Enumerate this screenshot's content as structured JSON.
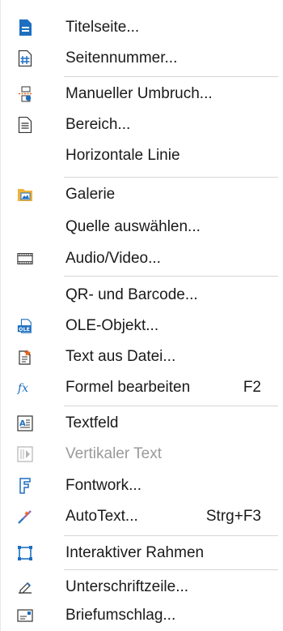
{
  "menu": {
    "items": [
      {
        "label": "Titelseite...",
        "icon": "title-page-icon",
        "shortcut": "",
        "enabled": true
      },
      {
        "label": "Seitennummer...",
        "icon": "page-number-icon",
        "shortcut": "",
        "enabled": true
      },
      {
        "label": "Manueller Umbruch...",
        "icon": "manual-break-icon",
        "shortcut": "",
        "enabled": true
      },
      {
        "label": "Bereich...",
        "icon": "section-icon",
        "shortcut": "",
        "enabled": true
      },
      {
        "label": "Horizontale Linie",
        "icon": "",
        "shortcut": "",
        "enabled": true
      },
      {
        "label": "Galerie",
        "icon": "gallery-icon",
        "shortcut": "",
        "enabled": true
      },
      {
        "label": "Quelle auswählen...",
        "icon": "",
        "shortcut": "",
        "enabled": true
      },
      {
        "label": "Audio/Video...",
        "icon": "audio-video-icon",
        "shortcut": "",
        "enabled": true
      },
      {
        "label": "QR- und Barcode...",
        "icon": "",
        "shortcut": "",
        "enabled": true
      },
      {
        "label": "OLE-Objekt...",
        "icon": "ole-object-icon",
        "shortcut": "",
        "enabled": true
      },
      {
        "label": "Text aus Datei...",
        "icon": "text-from-file-icon",
        "shortcut": "",
        "enabled": true
      },
      {
        "label": "Formel bearbeiten",
        "icon": "formula-icon",
        "shortcut": "F2",
        "enabled": true
      },
      {
        "label": "Textfeld",
        "icon": "text-box-icon",
        "shortcut": "",
        "enabled": true
      },
      {
        "label": "Vertikaler Text",
        "icon": "vertical-text-icon",
        "shortcut": "",
        "enabled": false
      },
      {
        "label": "Fontwork...",
        "icon": "fontwork-icon",
        "shortcut": "",
        "enabled": true
      },
      {
        "label": "AutoText...",
        "icon": "autotext-icon",
        "shortcut": "Strg+F3",
        "enabled": true
      },
      {
        "label": "Interaktiver Rahmen",
        "icon": "interactive-frame-icon",
        "shortcut": "",
        "enabled": true
      },
      {
        "label": "Unterschriftzeile...",
        "icon": "signature-line-icon",
        "shortcut": "",
        "enabled": true
      },
      {
        "label": "Briefumschlag...",
        "icon": "envelope-icon",
        "shortcut": "",
        "enabled": true
      }
    ]
  },
  "colors": {
    "accent": "#1e6fc0",
    "text": "#1a1a1a",
    "disabled": "#9a9a9a",
    "separator": "#d6d6d6"
  }
}
